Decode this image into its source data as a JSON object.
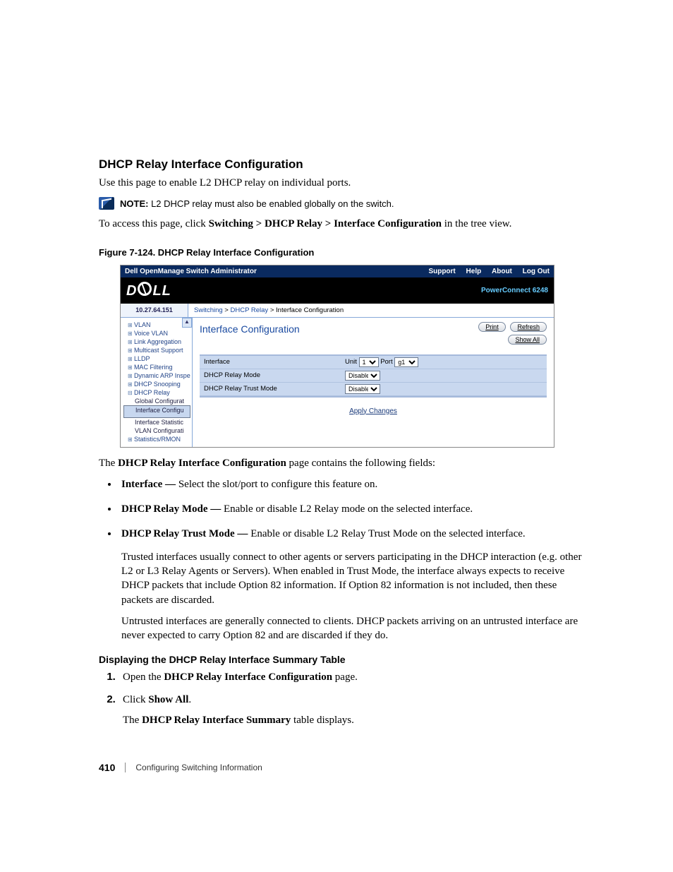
{
  "heading": "DHCP Relay Interface Configuration",
  "intro": "Use this page to enable L2 DHCP relay on individual ports.",
  "note_label": "NOTE:",
  "note_text": "L2 DHCP relay must also be enabled globally on the switch.",
  "access_pre": "To access this page, click ",
  "access_path": "Switching > DHCP Relay > Interface Configuration",
  "access_post": " in the tree view.",
  "figure_caption": "Figure 7-124.    DHCP Relay Interface Configuration",
  "screenshot": {
    "titlebar_left": "Dell OpenManage Switch Administrator",
    "titlebar_links": [
      "Support",
      "Help",
      "About",
      "Log Out"
    ],
    "device": "PowerConnect 6248",
    "ip": "10.27.64.151",
    "breadcrumb": [
      "Switching",
      "DHCP Relay",
      "Interface Configuration"
    ],
    "tree": {
      "items": [
        "VLAN",
        "Voice VLAN",
        "Link Aggregation",
        "Multicast Support",
        "LLDP",
        "MAC Filtering",
        "Dynamic ARP Inspe",
        "DHCP Snooping"
      ],
      "open_item": "DHCP Relay",
      "subs": [
        "Global Configurat",
        "Interface Configu",
        "Interface Statistic",
        "VLAN Configurati"
      ],
      "selected_sub": "Interface Configu",
      "last": "Statistics/RMON"
    },
    "page_title": "Interface Configuration",
    "buttons": {
      "print": "Print",
      "refresh": "Refresh",
      "showall": "Show All"
    },
    "form": {
      "row_interface": "Interface",
      "unit_label": "Unit",
      "unit_value": "1",
      "port_label": "Port",
      "port_value": "g1",
      "row_mode": "DHCP Relay Mode",
      "mode_value": "Disable",
      "row_trust": "DHCP Relay Trust Mode",
      "trust_value": "Disable",
      "apply": "Apply Changes"
    }
  },
  "fields_intro_pre": "The ",
  "fields_intro_bold": "DHCP Relay Interface Configuration",
  "fields_intro_post": " page contains the following fields:",
  "bullets": [
    {
      "term": "Interface —",
      "desc": " Select the slot/port to configure this feature on."
    },
    {
      "term": "DHCP Relay Mode —",
      "desc": " Enable or disable L2 Relay mode on the selected interface."
    },
    {
      "term": "DHCP Relay Trust Mode —",
      "desc": " Enable or disable L2 Relay Trust Mode on the selected interface."
    }
  ],
  "para1": "Trusted interfaces usually connect to other agents or servers participating in the DHCP interaction (e.g. other L2 or L3 Relay Agents or Servers). When enabled in Trust Mode, the interface always expects to receive DHCP packets that include Option 82 information. If Option 82 information is not included, then these packets are discarded.",
  "para2": "Untrusted interfaces are generally connected to clients. DHCP packets arriving on an untrusted interface are never expected to carry Option 82 and are discarded if they do.",
  "subhead": "Displaying the DHCP Relay Interface Summary Table",
  "steps": {
    "s1_pre": "Open the ",
    "s1_bold": "DHCP Relay Interface Configuration",
    "s1_post": " page.",
    "s2_pre": "Click ",
    "s2_bold": "Show All",
    "s2_post": ".",
    "s2b_pre": "The ",
    "s2b_bold": "DHCP Relay Interface Summary",
    "s2b_post": " table displays."
  },
  "footer": {
    "page": "410",
    "section": "Configuring Switching Information"
  }
}
